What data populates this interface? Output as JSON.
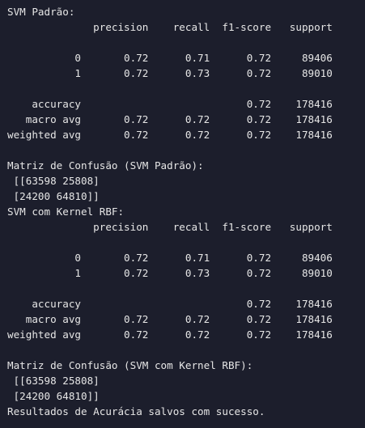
{
  "output": {
    "lines": [
      "SVM Padrão:",
      "              precision    recall  f1-score   support",
      "",
      "           0       0.72      0.71      0.72     89406",
      "           1       0.72      0.73      0.72     89010",
      "",
      "    accuracy                           0.72    178416",
      "   macro avg       0.72      0.72      0.72    178416",
      "weighted avg       0.72      0.72      0.72    178416",
      "",
      "Matriz de Confusão (SVM Padrão):",
      " [[63598 25808]",
      " [24200 64810]]",
      "SVM com Kernel RBF:",
      "              precision    recall  f1-score   support",
      "",
      "           0       0.72      0.71      0.72     89406",
      "           1       0.72      0.73      0.72     89010",
      "",
      "    accuracy                           0.72    178416",
      "   macro avg       0.72      0.72      0.72    178416",
      "weighted avg       0.72      0.72      0.72    178416",
      "",
      "Matriz de Confusão (SVM com Kernel RBF):",
      " [[63598 25808]",
      " [24200 64810]]",
      "Resultados de Acurácia salvos com sucesso."
    ]
  }
}
